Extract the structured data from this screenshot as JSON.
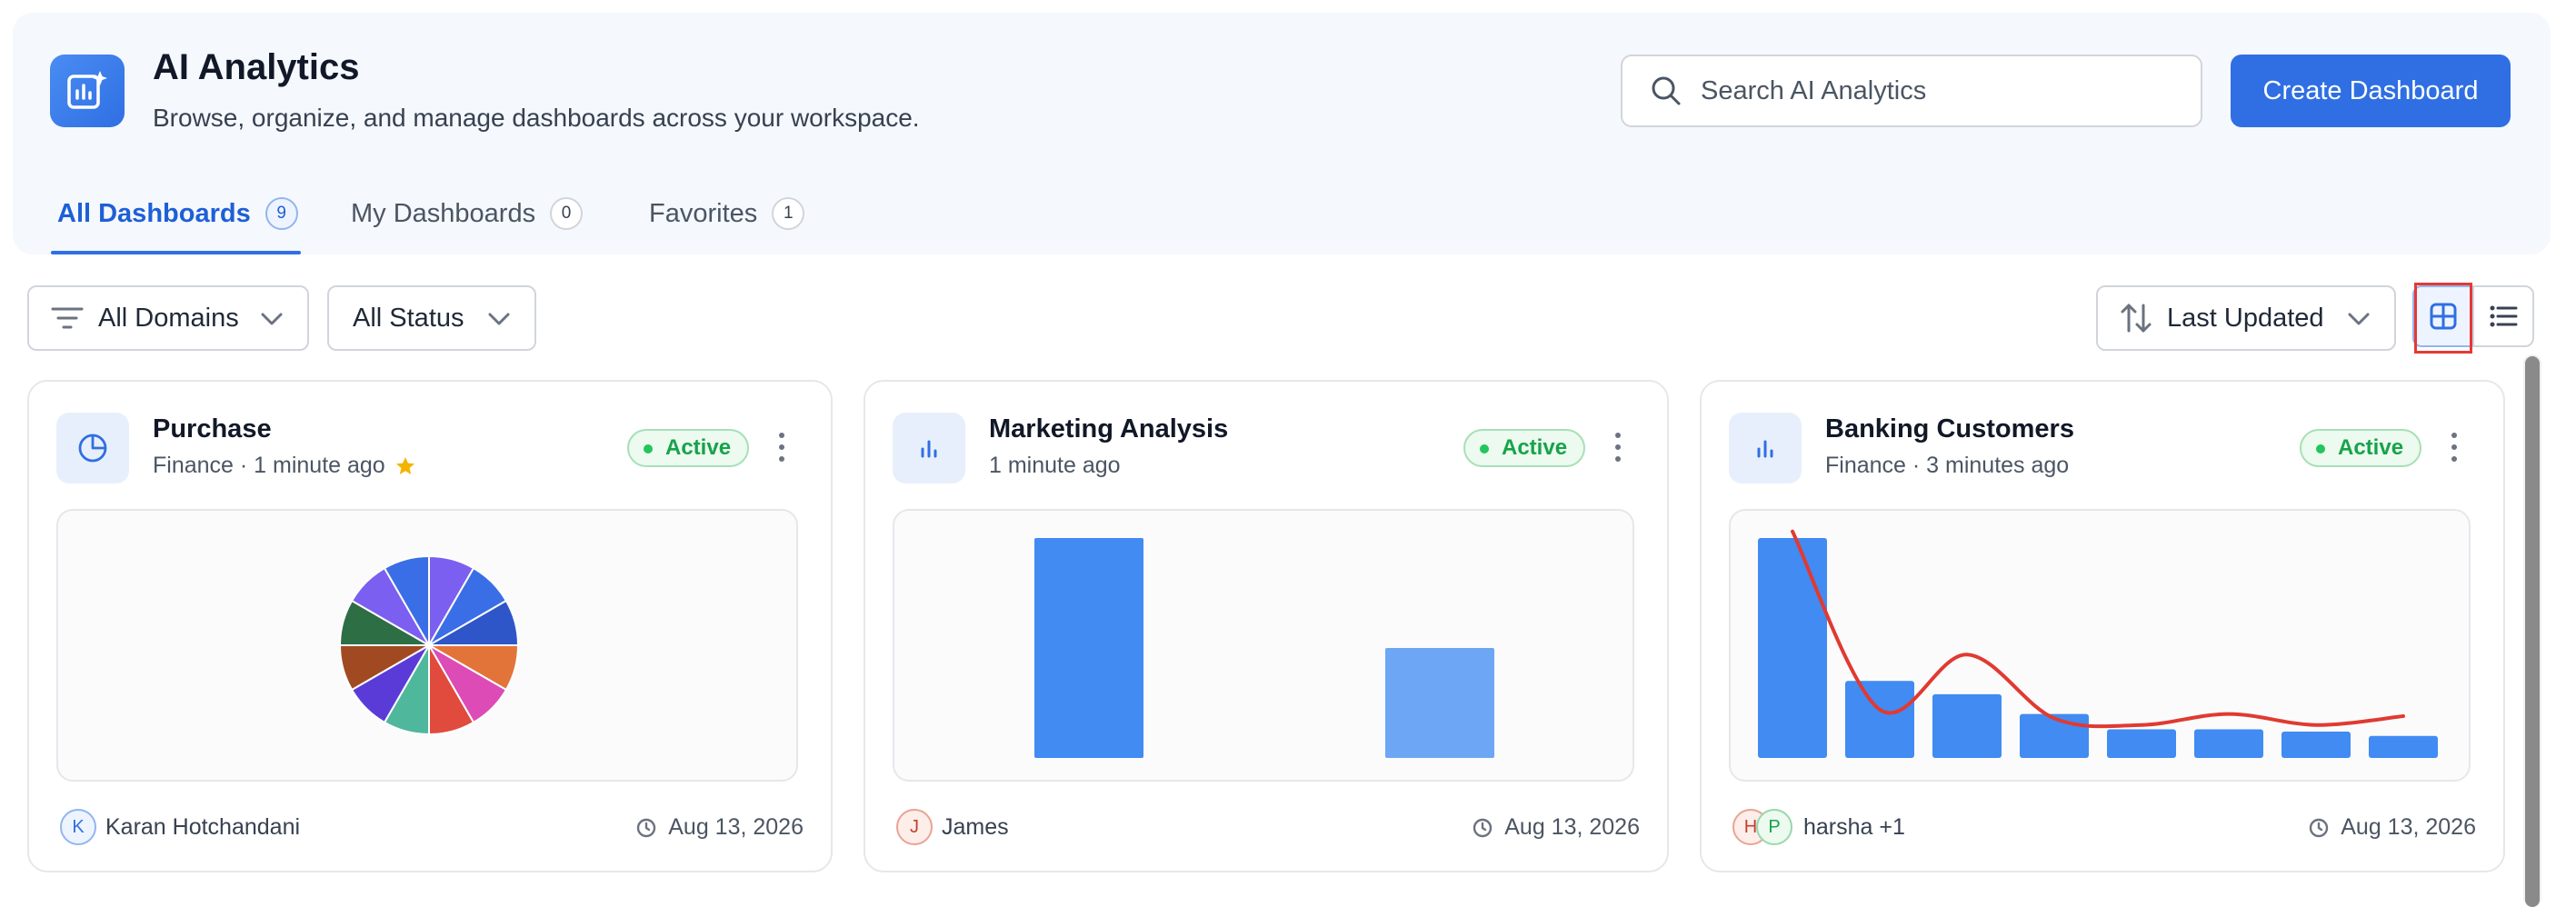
{
  "header": {
    "title": "AI Analytics",
    "subtitle": "Browse, organize, and manage dashboards across your workspace.",
    "search_placeholder": "Search AI Analytics",
    "create_label": "Create Dashboard",
    "app_icon": "analytics-sparkle-icon"
  },
  "tabs": [
    {
      "label": "All Dashboards",
      "count": "9",
      "active": true
    },
    {
      "label": "My Dashboards",
      "count": "0",
      "active": false
    },
    {
      "label": "Favorites",
      "count": "1",
      "active": false
    }
  ],
  "filters": {
    "domain": "All Domains",
    "status": "All Status",
    "sort": "Last Updated",
    "view_modes": [
      "grid",
      "list"
    ],
    "selected_view": "grid"
  },
  "cards": [
    {
      "title": "Purchase",
      "meta": "Finance · 1 minute ago",
      "favorite": true,
      "status": "Active",
      "icon": "pie-chart-icon",
      "owner_initial": "K",
      "owner": "Karan Hotchandani",
      "date": "Aug 13, 2026",
      "chart_data": {
        "type": "pie",
        "values": [
          1,
          1,
          1,
          1,
          1,
          1,
          1,
          1,
          1,
          1,
          1,
          1
        ],
        "colors": [
          "#7b5ff0",
          "#3a6ee6",
          "#2f56c9",
          "#e2743a",
          "#dc4bb6",
          "#e14b3e",
          "#4fb89c",
          "#5b3bd8",
          "#a14a22",
          "#2e6e45"
        ]
      }
    },
    {
      "title": "Marketing Analysis",
      "meta": "1 minute ago",
      "favorite": false,
      "status": "Active",
      "icon": "bar-chart-icon",
      "owner_initial": "J",
      "owner": "James",
      "date": "Aug 13, 2026",
      "chart_data": {
        "type": "bar",
        "values": [
          100,
          50
        ],
        "colors": [
          "#418bf3",
          "#6ea6f6"
        ]
      }
    },
    {
      "title": "Banking Customers",
      "meta": "Finance · 3 minutes ago",
      "favorite": false,
      "status": "Active",
      "icon": "bar-chart-icon",
      "owner_initials": [
        "H",
        "P"
      ],
      "owner": "harsha +1",
      "date": "Aug 13, 2026",
      "chart_data": {
        "type": "bar",
        "values": [
          100,
          35,
          29,
          20,
          13,
          13,
          12,
          10
        ],
        "line_values": [
          103,
          22,
          47,
          18,
          15,
          20,
          15,
          19
        ],
        "bar_color": "#418bf3",
        "line_color": "#e03a31"
      }
    }
  ]
}
